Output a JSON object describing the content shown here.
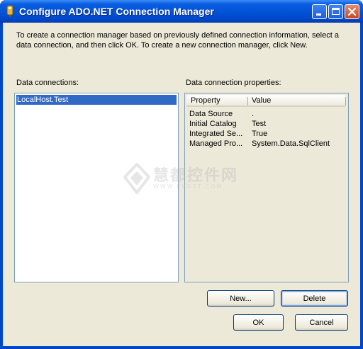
{
  "window": {
    "title": "Configure ADO.NET Connection Manager"
  },
  "intro_text": "To create a connection manager based on previously defined connection information, select a data connection, and then click OK. To create a new connection manager, click New.",
  "data_connections": {
    "label": "Data connections:",
    "items": [
      "LocalHost.Test"
    ],
    "selected_index": 0
  },
  "properties": {
    "label": "Data connection properties:",
    "columns": [
      "Property",
      "Value"
    ],
    "rows": [
      {
        "property": "Data Source",
        "value": "."
      },
      {
        "property": "Initial Catalog",
        "value": "Test"
      },
      {
        "property": "Integrated Se...",
        "value": "True"
      },
      {
        "property": "Managed Pro...",
        "value": "System.Data.SqlClient"
      }
    ]
  },
  "buttons": {
    "new": "New...",
    "delete": "Delete",
    "ok": "OK",
    "cancel": "Cancel"
  },
  "watermark": {
    "text": "慧都控件网",
    "url": "WWW.EVGET.COM"
  },
  "colors": {
    "titlebar": "#0052d6",
    "selection": "#316ac5",
    "dialog_bg": "#ece9d8"
  }
}
